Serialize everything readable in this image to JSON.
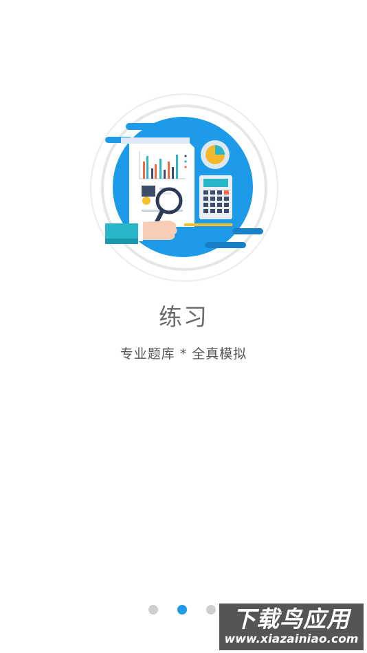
{
  "onboarding": {
    "title": "练习",
    "subtitle": "专业题库 * 全真模拟",
    "illustration": "practice-report-magnifier-calculator"
  },
  "pager": {
    "total_pages": 3,
    "active_page": 2
  },
  "watermark": {
    "main": "下载鸟应用",
    "sub": "www.xiazainiao.com"
  },
  "colors": {
    "accent": "#1e9be8",
    "title_text": "#6b6b6b",
    "inactive_dot": "#cfcfcf"
  }
}
